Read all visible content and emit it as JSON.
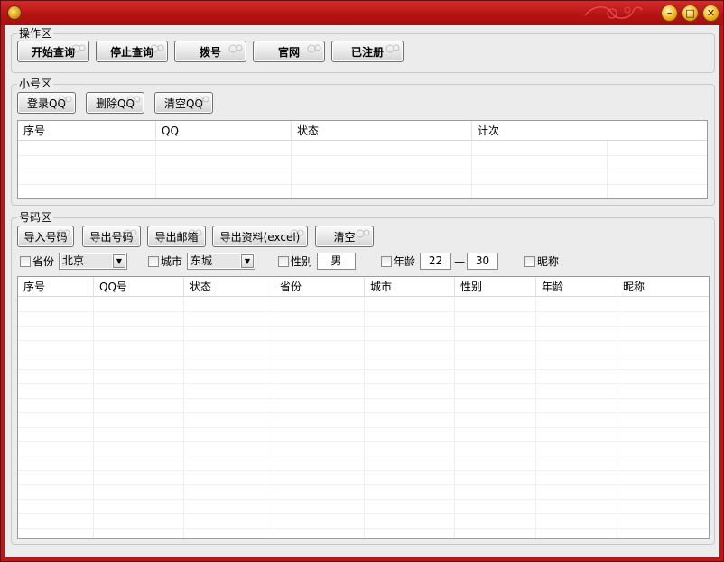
{
  "operation": {
    "title": "操作区",
    "buttons": [
      "开始查询",
      "停止查询",
      "拨号",
      "官网",
      "已注册"
    ]
  },
  "accounts": {
    "title": "小号区",
    "buttons": [
      "登录QQ",
      "删除QQ",
      "清空QQ"
    ],
    "columns": [
      "序号",
      "QQ",
      "状态",
      "计次"
    ]
  },
  "numbers": {
    "title": "号码区",
    "buttons": [
      "导入号码",
      "导出号码",
      "导出邮箱",
      "导出资料(excel)",
      "清空"
    ],
    "filters": {
      "province_label": "省份",
      "province_value": "北京",
      "city_label": "城市",
      "city_value": "东城",
      "gender_label": "性别",
      "gender_value": "男",
      "age_label": "年龄",
      "age_min": "22",
      "age_sep": "—",
      "age_max": "30",
      "nickname_label": "昵称"
    },
    "columns": [
      "序号",
      "QQ号",
      "状态",
      "省份",
      "城市",
      "性别",
      "年龄",
      "昵称"
    ]
  },
  "window": {
    "minimize": "–",
    "maximize": "□",
    "close": "✕"
  },
  "icons": {
    "app": "app-coin-icon",
    "button_ornament": "cloud-swirl-icon"
  },
  "colors": {
    "titlebar": "#c41e1e",
    "client": "#ececec",
    "window_button": "#f0b418"
  }
}
